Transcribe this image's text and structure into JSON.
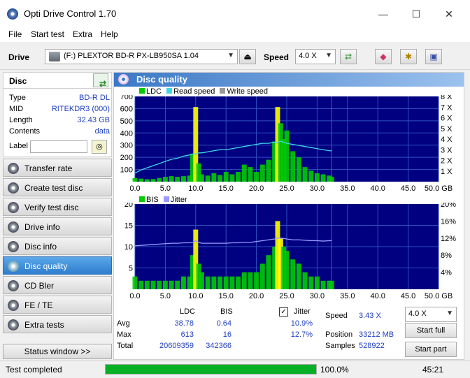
{
  "window": {
    "title": "Opti Drive Control 1.70",
    "minimize": "—",
    "maximize": "☐",
    "close": "✕"
  },
  "menu": [
    "File",
    "Start test",
    "Extra",
    "Help"
  ],
  "toolbar": {
    "drive_label": "Drive",
    "drive_value": "(F:)   PLEXTOR BD-R  PX-LB950SA 1.04",
    "speed_label": "Speed",
    "speed_value": "4.0 X"
  },
  "disc": {
    "header": "Disc",
    "rows": [
      {
        "key": "Type",
        "value": "BD-R DL"
      },
      {
        "key": "MID",
        "value": "RITEKDR3 (000)"
      },
      {
        "key": "Length",
        "value": "32.43 GB"
      },
      {
        "key": "Contents",
        "value": "data"
      }
    ],
    "label_key": "Label",
    "label_value": ""
  },
  "nav": [
    {
      "label": "Transfer rate",
      "active": false
    },
    {
      "label": "Create test disc",
      "active": false
    },
    {
      "label": "Verify test disc",
      "active": false
    },
    {
      "label": "Drive info",
      "active": false
    },
    {
      "label": "Disc info",
      "active": false
    },
    {
      "label": "Disc quality",
      "active": true
    },
    {
      "label": "CD Bler",
      "active": false
    },
    {
      "label": "FE / TE",
      "active": false
    },
    {
      "label": "Extra tests",
      "active": false
    }
  ],
  "status_window_button": "Status window >>",
  "panel_title": "Disc quality",
  "legend_top": {
    "ldc": "LDC",
    "read": "Read speed",
    "write": "Write speed"
  },
  "legend_bottom": {
    "bis": "BIS",
    "jitter": "Jitter"
  },
  "colors": {
    "ldc": "#00cc00",
    "read": "#3fd6e8",
    "write": "#999999",
    "bis": "#00cc00",
    "jitter": "#9a9aff",
    "chart_bg": "#000080",
    "grid": "#3050c0",
    "spike": "#ffff00"
  },
  "chart_data": [
    {
      "type": "area",
      "x": [
        0,
        1,
        2,
        3,
        4,
        5,
        6,
        7,
        8,
        9,
        9.5,
        10,
        10.5,
        11,
        12,
        13,
        14,
        15,
        16,
        17,
        18,
        19,
        20,
        21,
        22,
        23,
        23.5,
        24,
        24.5,
        25,
        26,
        27,
        28,
        29,
        30,
        31,
        32,
        32.4
      ],
      "series": [
        {
          "name": "LDC",
          "values": [
            30,
            25,
            20,
            22,
            30,
            40,
            45,
            40,
            45,
            50,
            230,
            613,
            150,
            60,
            50,
            70,
            55,
            80,
            60,
            80,
            140,
            120,
            80,
            140,
            180,
            330,
            613,
            480,
            350,
            420,
            250,
            200,
            120,
            90,
            70,
            60,
            50,
            40
          ]
        },
        {
          "name": "Read speed",
          "values": [
            0.8,
            1.1,
            1.3,
            1.5,
            1.7,
            1.9,
            2.1,
            2.2,
            2.4,
            2.5,
            2.6,
            2.6,
            2.7,
            2.7,
            2.8,
            2.9,
            3.0,
            3.0,
            3.1,
            3.2,
            3.3,
            3.4,
            3.5,
            3.6,
            3.6,
            3.7,
            3.7,
            3.8,
            3.7,
            3.6,
            3.5,
            3.4,
            3.3,
            3.2,
            3.1,
            3.0,
            2.9,
            2.9
          ]
        }
      ],
      "xlim": [
        0,
        50
      ],
      "ylim": [
        0,
        700
      ],
      "y2lim": [
        0,
        8
      ],
      "x_ticks": [
        "0.0",
        "5.0",
        "10.0",
        "15.0",
        "20.0",
        "25.0",
        "30.0",
        "35.0",
        "40.0",
        "45.0",
        "50.0 GB"
      ],
      "y_ticks": [
        "100",
        "200",
        "300",
        "400",
        "500",
        "600",
        "700"
      ],
      "y2_ticks": [
        "1 X",
        "2 X",
        "3 X",
        "4 X",
        "5 X",
        "6 X",
        "7 X",
        "8 X"
      ]
    },
    {
      "type": "area",
      "x": [
        0,
        1,
        2,
        3,
        4,
        5,
        6,
        7,
        8,
        9,
        9.5,
        10,
        10.5,
        11,
        12,
        13,
        14,
        15,
        16,
        17,
        18,
        19,
        20,
        21,
        22,
        23,
        23.5,
        24,
        24.5,
        25,
        26,
        27,
        28,
        29,
        30,
        31,
        32,
        32.4
      ],
      "series": [
        {
          "name": "BIS",
          "values": [
            3,
            2,
            2,
            2,
            2,
            2,
            2,
            2,
            3,
            3,
            8,
            14,
            6,
            4,
            3,
            3,
            3,
            3,
            3,
            3,
            4,
            4,
            4,
            6,
            8,
            10,
            16,
            12,
            10,
            9,
            7,
            6,
            4,
            3,
            3,
            2,
            2,
            2
          ]
        },
        {
          "name": "Jitter",
          "values": [
            10.2,
            10.3,
            10.4,
            10.5,
            10.6,
            10.7,
            10.8,
            10.8,
            10.9,
            10.9,
            11.0,
            11.4,
            11.0,
            10.8,
            10.8,
            10.8,
            10.8,
            10.8,
            10.9,
            10.9,
            11.0,
            11.0,
            11.2,
            11.4,
            11.6,
            11.8,
            12.0,
            12.0,
            11.9,
            11.8,
            11.6,
            11.6,
            11.5,
            11.4,
            11.4,
            11.3,
            11.4,
            11.4
          ]
        }
      ],
      "xlim": [
        0,
        50
      ],
      "ylim": [
        0,
        20
      ],
      "y2lim": [
        0,
        20
      ],
      "x_ticks": [
        "0.0",
        "5.0",
        "10.0",
        "15.0",
        "20.0",
        "25.0",
        "30.0",
        "35.0",
        "40.0",
        "45.0",
        "50.0 GB"
      ],
      "y_ticks": [
        "5",
        "10",
        "15",
        "20"
      ],
      "y2_ticks": [
        "4%",
        "8%",
        "12%",
        "16%",
        "20%"
      ]
    }
  ],
  "stats": {
    "col_ldc": "LDC",
    "col_bis": "BIS",
    "jitter_label": "Jitter",
    "avg_label": "Avg",
    "max_label": "Max",
    "total_label": "Total",
    "avg_ldc": "38.78",
    "avg_bis": "0.64",
    "avg_jitter": "10.9%",
    "max_ldc": "613",
    "max_bis": "16",
    "max_jitter": "12.7%",
    "total_ldc": "20609359",
    "total_bis": "342366",
    "jitter_checked": "✓"
  },
  "run_info": {
    "speed_label": "Speed",
    "speed_value": "3.43 X",
    "position_label": "Position",
    "position_value": "33212 MB",
    "samples_label": "Samples",
    "samples_value": "528922",
    "speed_select": "4.0 X",
    "start_full": "Start full",
    "start_part": "Start part"
  },
  "status": {
    "text": "Test completed",
    "progress": 1.0,
    "progress_text": "100.0%",
    "time": "45:21"
  }
}
